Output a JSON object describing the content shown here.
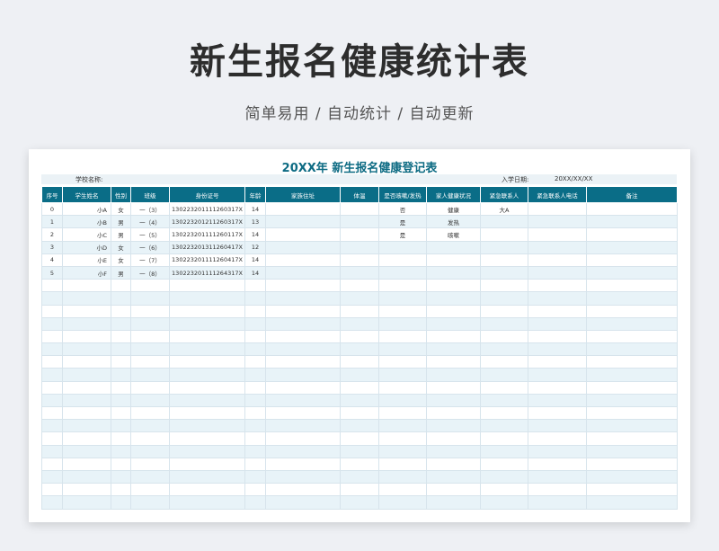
{
  "header": {
    "title": "新生报名健康统计表",
    "subtitle": "简单易用 / 自动统计 / 自动更新"
  },
  "sheet": {
    "title": "20XX年 新生报名健康登记表",
    "school_label": "学校名称:",
    "date_label": "入学日期:",
    "date_value": "20XX/XX/XX",
    "columns": [
      "序号",
      "学生姓名",
      "性别",
      "班级",
      "身份证号",
      "年龄",
      "家族住址",
      "体温",
      "是否咳嗽/发热",
      "家人健康状况",
      "紧急联系人",
      "紧急联系人电话",
      "备注"
    ],
    "rows": [
      [
        "0",
        "小A",
        "女",
        "一（3）",
        "130223201111260317X",
        "14",
        "",
        "",
        "否",
        "健康",
        "大A",
        "",
        ""
      ],
      [
        "1",
        "小B",
        "男",
        "一（4）",
        "130223201211260317X",
        "13",
        "",
        "",
        "是",
        "发热",
        "",
        "",
        ""
      ],
      [
        "2",
        "小C",
        "男",
        "一（5）",
        "130223201111260117X",
        "14",
        "",
        "",
        "是",
        "咳嗽",
        "",
        "",
        ""
      ],
      [
        "3",
        "小D",
        "女",
        "一（6）",
        "130223201311260417X",
        "12",
        "",
        "",
        "",
        "",
        "",
        "",
        ""
      ],
      [
        "4",
        "小E",
        "女",
        "一（7）",
        "130223201111260417X",
        "14",
        "",
        "",
        "",
        "",
        "",
        "",
        ""
      ],
      [
        "5",
        "小F",
        "男",
        "一（8）",
        "130223201111264317X",
        "14",
        "",
        "",
        "",
        "",
        "",
        "",
        ""
      ]
    ]
  }
}
